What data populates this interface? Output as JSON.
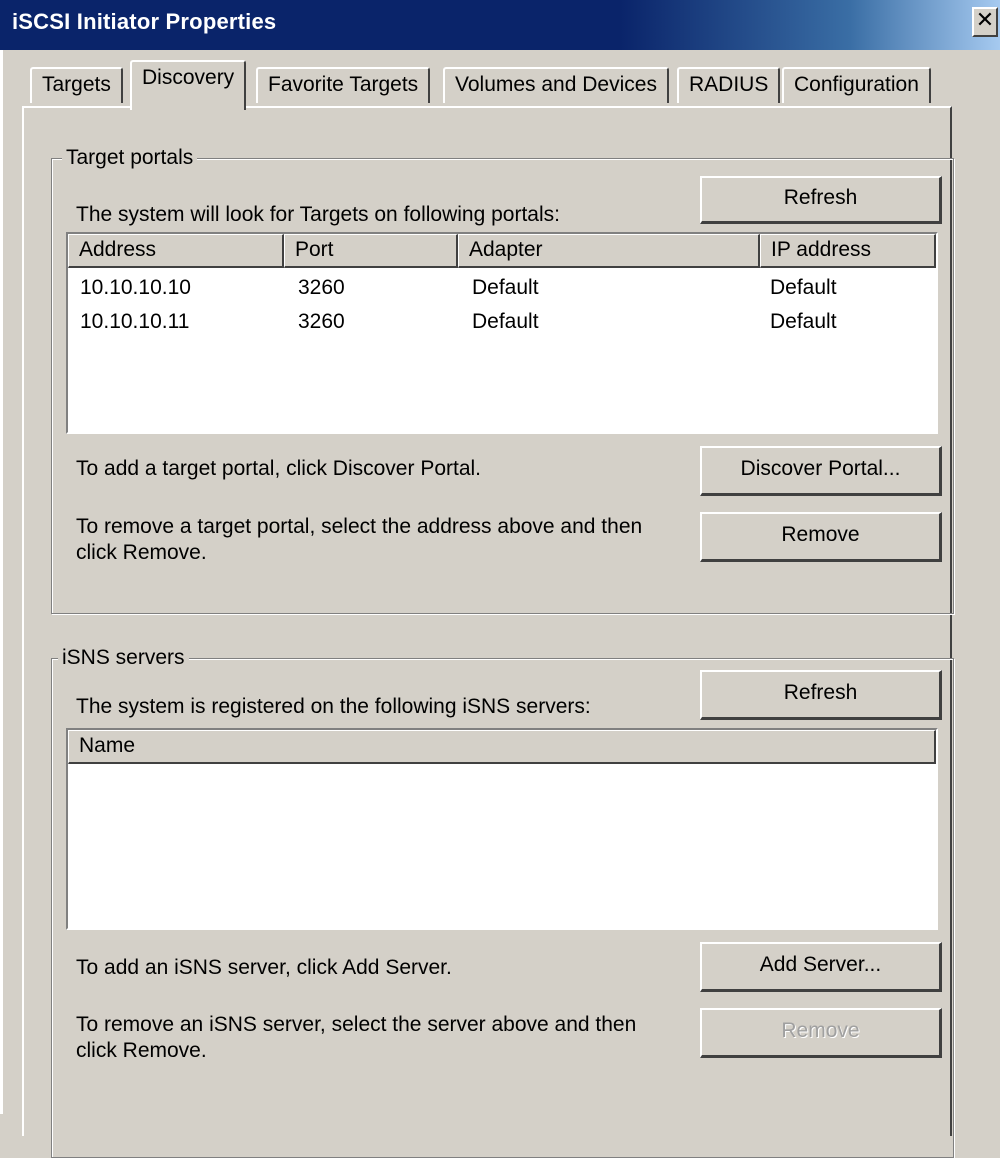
{
  "window": {
    "title": "iSCSI Initiator Properties",
    "close_glyph": "✕"
  },
  "tabs": [
    {
      "label": "Targets",
      "active": false
    },
    {
      "label": "Discovery",
      "active": true
    },
    {
      "label": "Favorite Targets",
      "active": false
    },
    {
      "label": "Volumes and Devices",
      "active": false
    },
    {
      "label": "RADIUS",
      "active": false
    },
    {
      "label": "Configuration",
      "active": false
    }
  ],
  "target_portals": {
    "group_label": "Target portals",
    "description": "The system will look for Targets on following portals:",
    "refresh_label": "Refresh",
    "columns": [
      "Address",
      "Port",
      "Adapter",
      "IP address"
    ],
    "rows": [
      [
        "10.10.10.10",
        "3260",
        "Default",
        "Default"
      ],
      [
        "10.10.10.11",
        "3260",
        "Default",
        "Default"
      ]
    ],
    "add_hint": "To add a target portal, click Discover Portal.",
    "discover_label": "Discover Portal...",
    "remove_hint": "To remove a target portal, select the address above and then click Remove.",
    "remove_label": "Remove"
  },
  "isns_servers": {
    "group_label": "iSNS servers",
    "description": "The system is registered on the following iSNS servers:",
    "refresh_label": "Refresh",
    "columns": [
      "Name"
    ],
    "rows": [],
    "add_hint": "To add an iSNS server, click Add Server.",
    "add_label": "Add Server...",
    "remove_hint": "To remove an iSNS server, select the server above and then click Remove.",
    "remove_label": "Remove",
    "remove_disabled": true
  },
  "colors": {
    "face": "#d4d0c8",
    "titlebar": "#0a246a",
    "disabled_text": "#a0a0a0"
  }
}
